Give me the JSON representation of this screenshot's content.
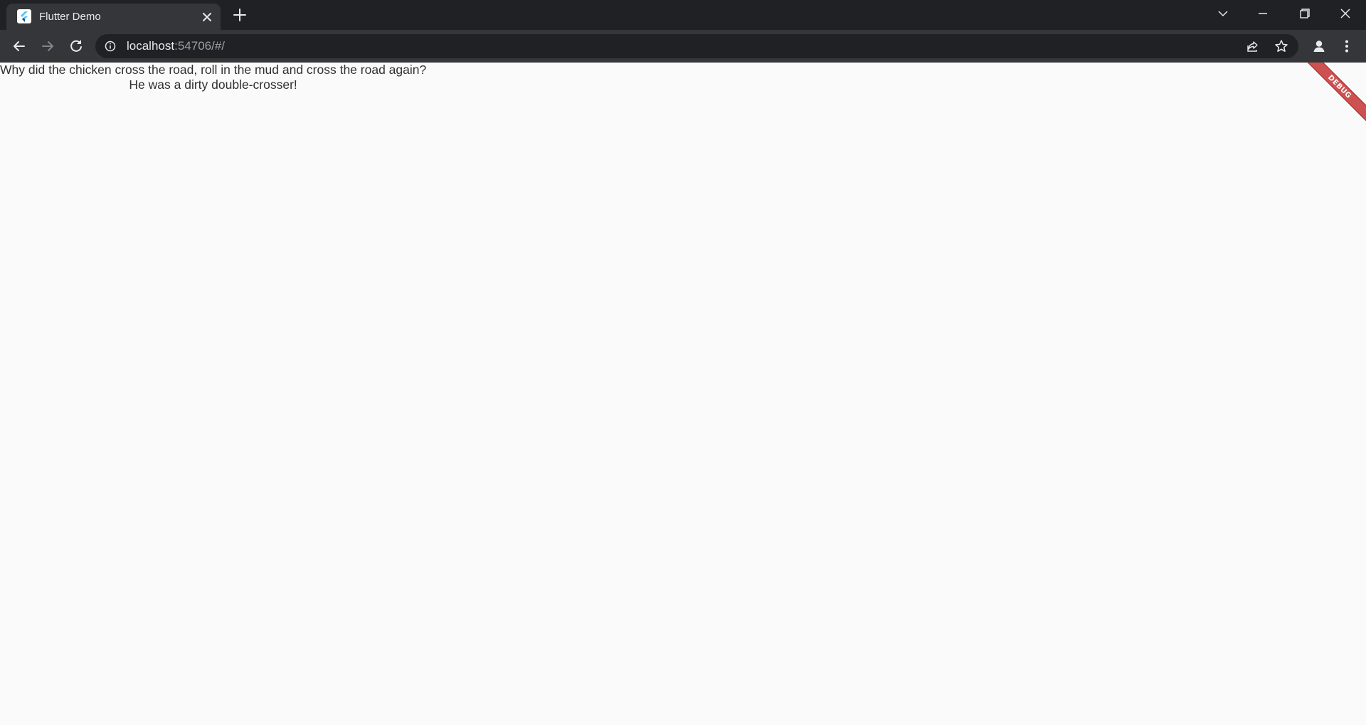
{
  "browser": {
    "tab": {
      "title": "Flutter Demo",
      "favicon_icon": "flutter-logo-icon"
    },
    "address_bar": {
      "host": "localhost",
      "rest": ":54706/#/"
    },
    "colors": {
      "chrome_dark": "#202124",
      "chrome_tab": "#35363a",
      "icon": "#e8eaed",
      "icon_disabled": "#80868b"
    }
  },
  "page": {
    "background": "#fafafa",
    "joke": {
      "question": "Why did the chicken cross the road, roll in the mud and cross the road again?",
      "answer": "He was a dirty double-crosser!"
    },
    "debug_banner": "DEBUG"
  }
}
